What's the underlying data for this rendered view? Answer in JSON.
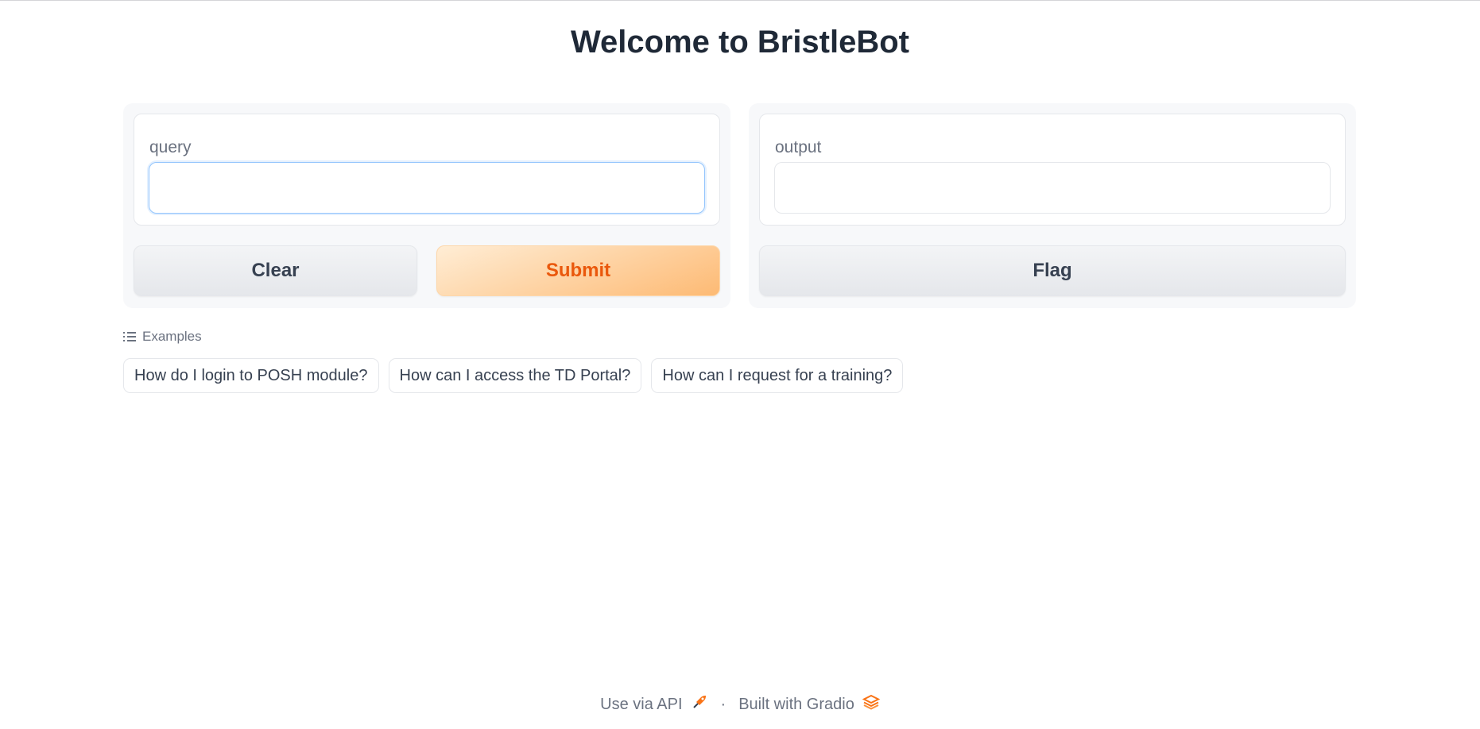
{
  "page": {
    "title": "Welcome to BristleBot"
  },
  "input_panel": {
    "query_label": "query",
    "query_value": "",
    "clear_label": "Clear",
    "submit_label": "Submit"
  },
  "output_panel": {
    "output_label": "output",
    "output_value": "",
    "flag_label": "Flag"
  },
  "examples": {
    "header": "Examples",
    "items": [
      "How do I login to POSH module?",
      "How can I access the TD Portal?",
      "How can I request for a training?"
    ]
  },
  "footer": {
    "api_label": "Use via API",
    "api_icon": "rocket-icon",
    "separator": "·",
    "built_label": "Built with Gradio",
    "built_icon": "gradio-logo-icon"
  },
  "colors": {
    "accent": "#ea580c",
    "accent_bg": "#fdba74",
    "focus_ring": "#93c5fd"
  }
}
